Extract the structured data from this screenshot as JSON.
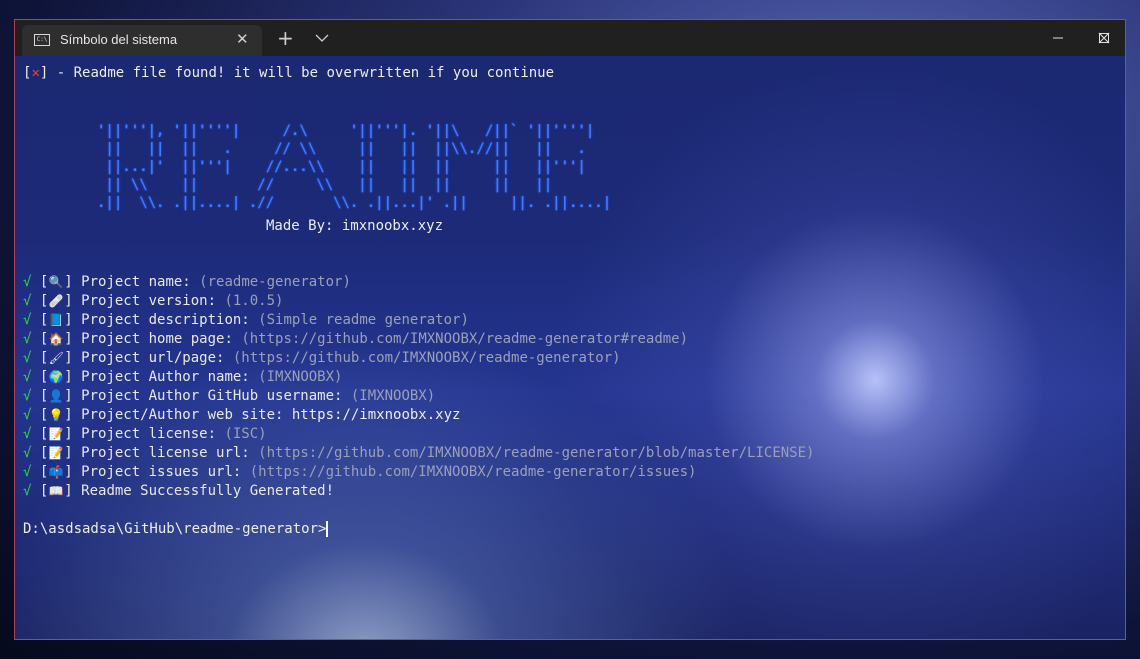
{
  "window": {
    "tab_title": "Símbolo del sistema",
    "tab_close": "✕",
    "new_tab": "+",
    "minimize": "—",
    "maximize": "☐",
    "close": "✕"
  },
  "terminal": {
    "warning": {
      "open": "[",
      "mark": "✕",
      "close": "]",
      "text": " - Readme file found! it will be overwritten if you continue"
    },
    "banner": [
      "'||'''|, '||''''|     /.\\     '||'''|. '||\\   /||` '||''''|",
      " ||   ||  ||   .     // \\\\     ||   ||  ||\\\\.//||   ||   .",
      " ||...|'  ||'''|    //...\\\\    ||   ||  ||     ||   ||'''|",
      " || \\\\    ||       //     \\\\   ||   ||  ||     ||   ||",
      ".||  \\\\. .||....| .//       \\\\. .||...|' .||     ||. .||....|"
    ],
    "made_by": "Made By: imxnoobx.xyz",
    "answers": [
      {
        "check": "√",
        "icon": "🔍",
        "label": "Project name: ",
        "value": "(readme-generator)"
      },
      {
        "check": "√",
        "icon": "🩹",
        "label": "Project version: ",
        "value": "(1.0.5)"
      },
      {
        "check": "√",
        "icon": "📘",
        "label": "Project description: ",
        "value": "(Simple readme generator)"
      },
      {
        "check": "√",
        "icon": "🏠",
        "label": "Project home page: ",
        "value": "(https://github.com/IMXNOOBX/readme-generator#readme)"
      },
      {
        "check": "√",
        "icon": "🖌",
        "label": "Project url/page: ",
        "value": "(https://github.com/IMXNOOBX/readme-generator)"
      },
      {
        "check": "√",
        "icon": "🌍",
        "label": "Project Author name: ",
        "value": "(IMXNOOBX)"
      },
      {
        "check": "√",
        "icon": "👤",
        "label": "Project Author GitHub username: ",
        "value": "(IMXNOOBX)"
      },
      {
        "check": "√",
        "icon": "💡",
        "label": "Project/Author web site: ",
        "value": "https://imxnoobx.xyz",
        "value_plain": true
      },
      {
        "check": "√",
        "icon": "📝",
        "label": "Project license: ",
        "value": "(ISC)"
      },
      {
        "check": "√",
        "icon": "📝",
        "label": "Project license url: ",
        "value": "(https://github.com/IMXNOOBX/readme-generator/blob/master/LICENSE)"
      },
      {
        "check": "√",
        "icon": "📫",
        "label": "Project issues url: ",
        "value": "(https://github.com/IMXNOOBX/readme-generator/issues)"
      },
      {
        "check": "√",
        "icon": "📖",
        "label": "Readme Successfully Generated!",
        "value": ""
      }
    ],
    "prompt": "D:\\asdsadsa\\GitHub\\readme-generator>"
  },
  "colors": {
    "check": "#2fd64c",
    "cross": "#ff3a3a",
    "banner": "#3e7bff",
    "value": "#9aa0b8"
  }
}
